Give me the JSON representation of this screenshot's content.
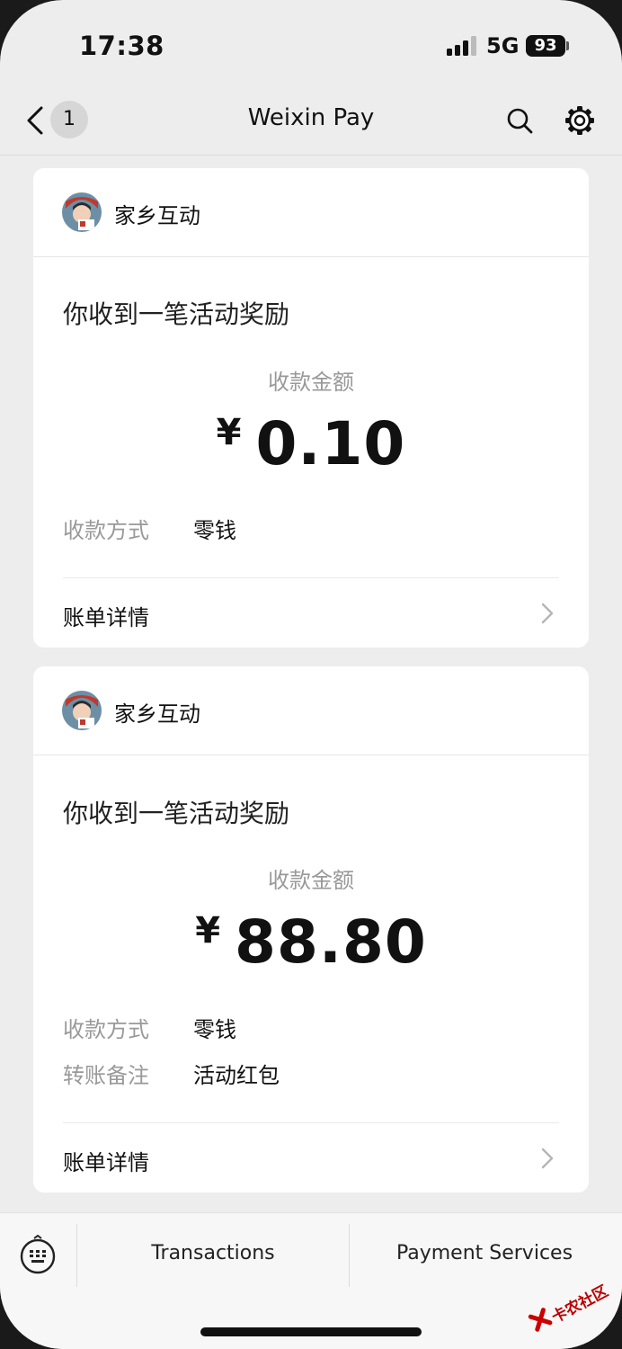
{
  "status_bar": {
    "time": "17:38",
    "network": "5G",
    "battery": "93"
  },
  "nav": {
    "back_count": "1",
    "title": "Weixin Pay"
  },
  "cards": [
    {
      "sender": "家乡互动",
      "title": "你收到一笔活动奖励",
      "amount_label": "收款金额",
      "currency": "¥",
      "amount": "0.10",
      "rows": [
        {
          "label": "收款方式",
          "value": "零钱"
        }
      ],
      "detail_label": "账单详情"
    },
    {
      "sender": "家乡互动",
      "title": "你收到一笔活动奖励",
      "amount_label": "收款金额",
      "currency": "¥",
      "amount": "88.80",
      "rows": [
        {
          "label": "收款方式",
          "value": "零钱"
        },
        {
          "label": "转账备注",
          "value": "活动红包"
        }
      ],
      "detail_label": "账单详情"
    }
  ],
  "bottom_bar": {
    "tabs": [
      {
        "label": "Transactions"
      },
      {
        "label": "Payment Services"
      }
    ]
  },
  "watermark": {
    "text": "卡农社区"
  },
  "colors": {
    "background": "#ededed",
    "card": "#ffffff",
    "label_gray": "#999999"
  }
}
